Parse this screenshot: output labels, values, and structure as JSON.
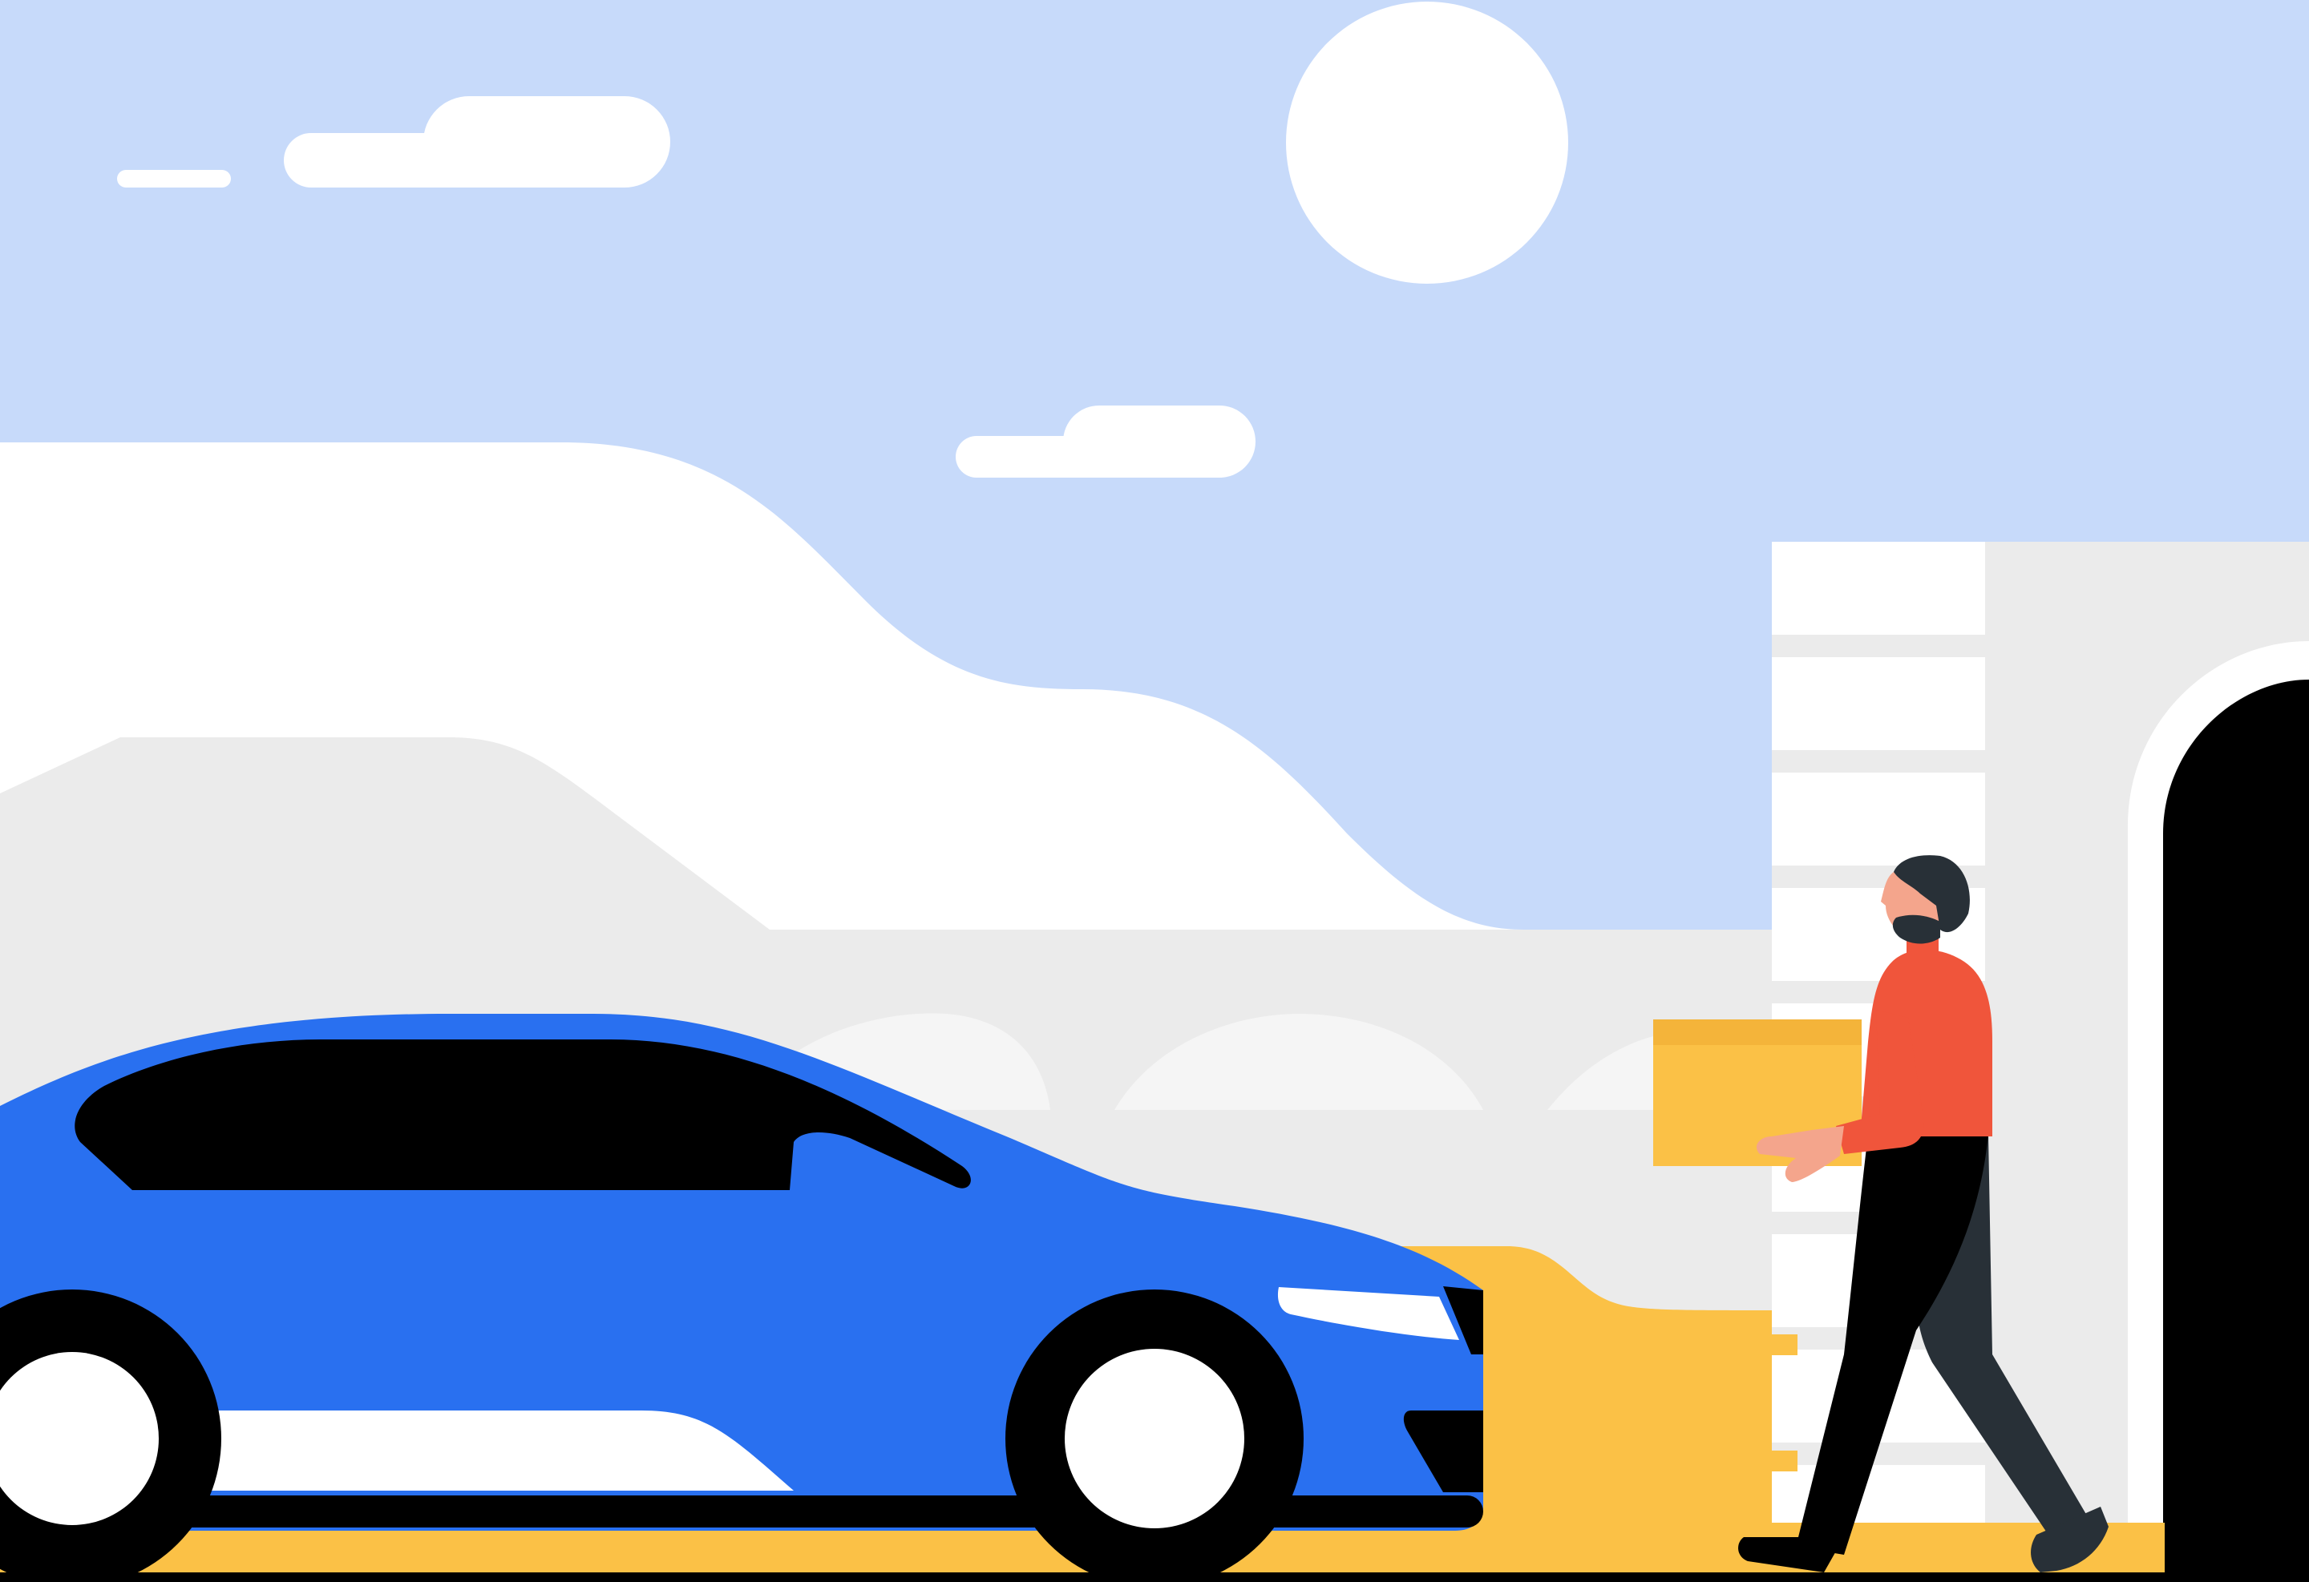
{
  "scene": {
    "description_free": true,
    "colors": {
      "sky": "#c7dafa",
      "cloud": "#ffffff",
      "sun": "#ffffff",
      "hill_white": "#ffffff",
      "hill_grey": "#ebebeb",
      "building_wall": "#ebebeb",
      "building_light": "#f5f5f5",
      "doorway": "#000000",
      "car_body": "#2970f0",
      "car_window": "#000000",
      "tire": "#000000",
      "hubcap": "#ffffff",
      "ground": "#fbc146",
      "box": "#fbc146",
      "box_lid": "#f4b43a",
      "shirt": "#f0553b",
      "pants_front": "#000000",
      "pants_back": "#283037",
      "skin": "#f4a58c",
      "hair": "#283037"
    },
    "icons": {
      "sun": "sun-icon",
      "car": "car-icon",
      "person": "person-carrying-box-icon",
      "package": "package-box-icon",
      "door": "doorway-icon"
    }
  }
}
